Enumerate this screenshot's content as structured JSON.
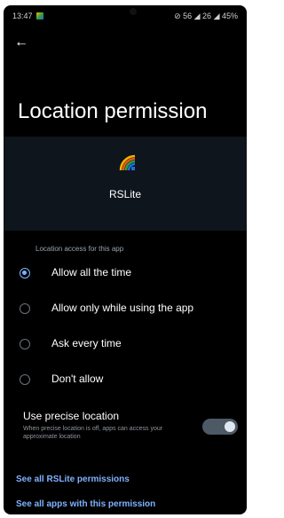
{
  "status_bar": {
    "time": "13:47",
    "right": "⊘ 56 ◢ 26 ◢ 45%"
  },
  "header": {
    "back_icon": "arrow-left-icon",
    "title": "Location permission"
  },
  "app": {
    "name": "RSLite",
    "icon": "app-logo-icon"
  },
  "section_label": "Location access for this app",
  "options": [
    {
      "label": "Allow all the time",
      "selected": true
    },
    {
      "label": "Allow only while using the app",
      "selected": false
    },
    {
      "label": "Ask every time",
      "selected": false
    },
    {
      "label": "Don't allow",
      "selected": false
    }
  ],
  "precise_location": {
    "title": "Use precise location",
    "description": "When precise location is off, apps can access your approximate location",
    "enabled": true
  },
  "links": {
    "app_permissions": "See all RSLite permissions",
    "all_apps": "See all apps with this permission"
  },
  "colors": {
    "accent": "#7fb2ff",
    "background": "#000000",
    "card": "#0f151c"
  }
}
